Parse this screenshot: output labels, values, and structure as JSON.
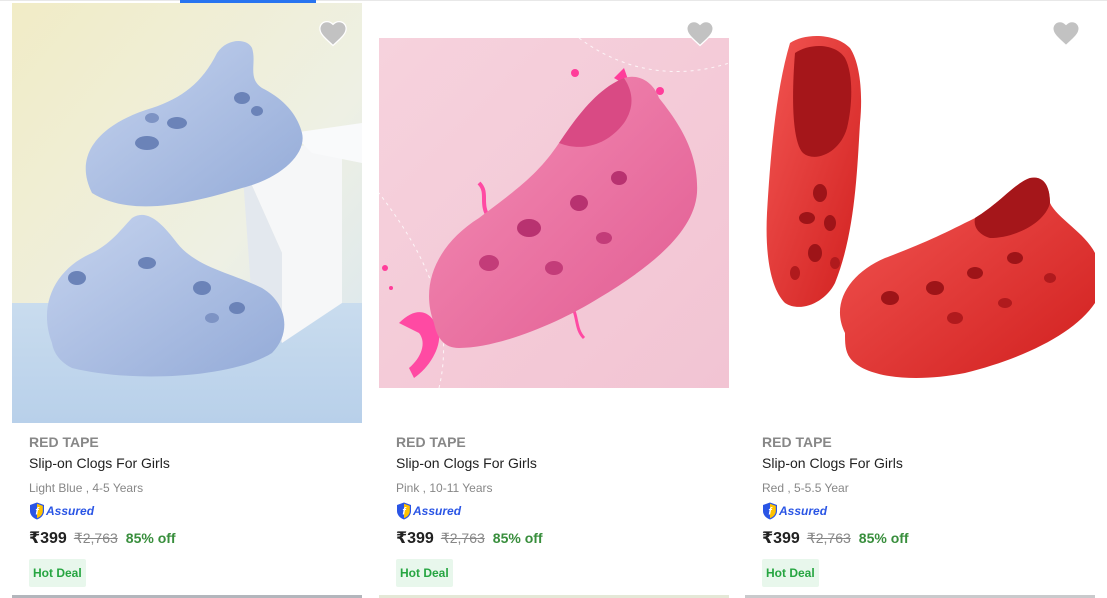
{
  "theme": {
    "accent": "#2874f0",
    "discount_color": "#388e3c",
    "badge_bg": "#e8f7ec",
    "badge_text": "#26a541",
    "assured_color": "#2a55e5"
  },
  "products": [
    {
      "brand": "RED TAPE",
      "title": "Slip-on Clogs For Girls",
      "variant": "Light Blue , 4-5 Years",
      "assured_label": "Assured",
      "price": "₹399",
      "mrp": "₹2,763",
      "discount": "85% off",
      "badge": "Hot Deal",
      "product_color": "#a9bde0",
      "wishlist_icon": "heart-icon"
    },
    {
      "brand": "RED TAPE",
      "title": "Slip-on Clogs For Girls",
      "variant": "Pink , 10-11 Years",
      "assured_label": "Assured",
      "price": "₹399",
      "mrp": "₹2,763",
      "discount": "85% off",
      "badge": "Hot Deal",
      "product_color": "#ec6fa2",
      "wishlist_icon": "heart-icon"
    },
    {
      "brand": "RED TAPE",
      "title": "Slip-on Clogs For Girls",
      "variant": "Red , 5-5.5 Year",
      "assured_label": "Assured",
      "price": "₹399",
      "mrp": "₹2,763",
      "discount": "85% off",
      "badge": "Hot Deal",
      "product_color": "#e0312e",
      "wishlist_icon": "heart-icon"
    }
  ]
}
